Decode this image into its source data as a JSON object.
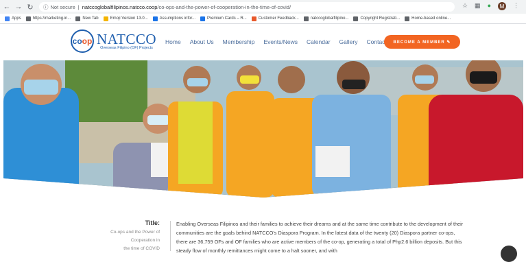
{
  "browser": {
    "security_label": "Not secure",
    "url_host": "natccoglobalfilipinos.natcco.coop",
    "url_path": "/co-ops-and-the-power-of-cooperation-in-the-time-of-covid/",
    "avatar_letter": "M",
    "bookmarks": [
      {
        "label": "Apps",
        "color": "#4285f4"
      },
      {
        "label": "https://marketing.in...",
        "color": "#5f6368"
      },
      {
        "label": "New Tab",
        "color": "#5f6368"
      },
      {
        "label": "Emoji Version 13.0...",
        "color": "#f4b400"
      },
      {
        "label": "Assumptions infor...",
        "color": "#1a73e8"
      },
      {
        "label": "Premium Cards – R...",
        "color": "#1a73e8"
      },
      {
        "label": "Customer Feedback...",
        "color": "#e8592b"
      },
      {
        "label": "natccoglobalfilipino...",
        "color": "#5f6368"
      },
      {
        "label": "Copyright Registrati...",
        "color": "#5f6368"
      },
      {
        "label": "Home-based online...",
        "color": "#5f6368"
      }
    ]
  },
  "site": {
    "logo_name": "NATCCO",
    "logo_sub": "Overseas Filipino (OF) Projects",
    "logo_mark_1": "co",
    "logo_mark_2": "op",
    "nav": [
      "Home",
      "About Us",
      "Membership",
      "Events/News",
      "Calendar",
      "Gallery",
      "Contact Us"
    ],
    "cta": "BECOME A MEMBER ✎",
    "brand_color": "#1f5fae",
    "accent_color": "#f26522"
  },
  "article": {
    "title_label": "Title:",
    "title_text_1": "Co-ops and the Power of Cooperation in",
    "title_text_2": "the time of COVID",
    "body": "Enabling Overseas Filipinos and their families to achieve their dreams and at the same time contribute to the development of their communities are the goals behind NATCCO's Diaspora Program.  In the latest data of the twenty (20) Diaspora partner co-ops, there are 36,759 OFs and OF families who are active members of the co-op, generating a total of Php2.6 billion deposits.  But this steady flow of monthly remittances might come to a halt sooner, and with"
  }
}
